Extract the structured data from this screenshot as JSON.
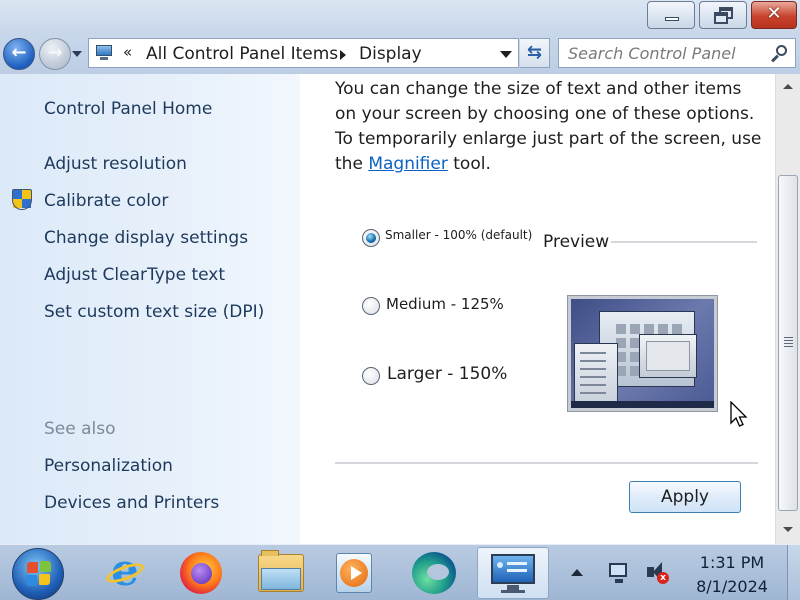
{
  "window": {
    "controls": {
      "minimize": "minimize",
      "maximize": "restore",
      "close": "✕"
    }
  },
  "address_bar": {
    "overflow_glyph": "«",
    "breadcrumbs": [
      "All Control Panel Items",
      "Display"
    ],
    "refresh_glyph": "⇆"
  },
  "search": {
    "placeholder": "Search Control Panel"
  },
  "sidebar": {
    "home": "Control Panel Home",
    "links": [
      "Adjust resolution",
      "Calibrate color",
      "Change display settings",
      "Adjust ClearType text",
      "Set custom text size (DPI)"
    ],
    "see_also_heading": "See also",
    "see_also": [
      "Personalization",
      "Devices and Printers"
    ]
  },
  "main": {
    "intro_before": "You can change the size of text and other items on your screen by choosing one of these options. To temporarily enlarge just part of the screen, use the ",
    "magnifier_link": "Magnifier",
    "intro_after": " tool.",
    "options": [
      {
        "label": "Smaller - 100% (default)",
        "selected": true
      },
      {
        "label": "Medium - 125%",
        "selected": false
      },
      {
        "label": "Larger - 150%",
        "selected": false
      }
    ],
    "preview_title": "Preview",
    "apply_label": "Apply"
  },
  "taskbar": {
    "apps": [
      "internet-explorer",
      "firefox",
      "windows-explorer",
      "media-player",
      "edge",
      "display-control-panel"
    ],
    "clock_time": "1:31 PM",
    "clock_date": "8/1/2024"
  },
  "colors": {
    "accent_link": "#0b62c4",
    "sidebar_link": "#1e395b",
    "sidebar_bg": "#dbe9f8",
    "close_button": "#c8432e"
  }
}
